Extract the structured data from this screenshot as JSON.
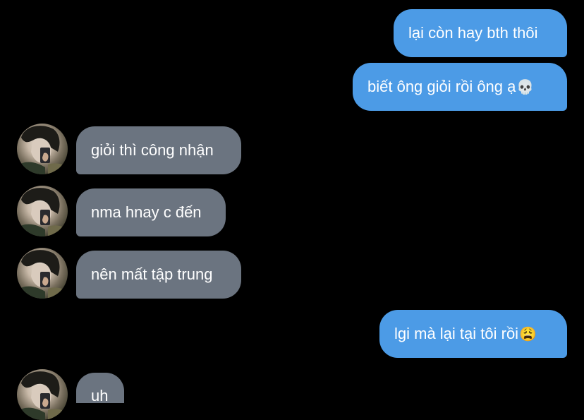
{
  "messages": [
    {
      "id": "m1",
      "direction": "sent",
      "text": "lại còn hay bth thôi",
      "emoji": ""
    },
    {
      "id": "m2",
      "direction": "sent",
      "text": "biết ông giỏi rồi ông ạ",
      "emoji": "💀"
    },
    {
      "id": "m3",
      "direction": "received",
      "text": "giỏi thì công nhận",
      "emoji": ""
    },
    {
      "id": "m4",
      "direction": "received",
      "text": "nma hnay c đến",
      "emoji": ""
    },
    {
      "id": "m5",
      "direction": "received",
      "text": "nên mất tập trung",
      "emoji": ""
    },
    {
      "id": "m6",
      "direction": "sent",
      "text": "lgi mà lại tại tôi rồi",
      "emoji": "😩"
    },
    {
      "id": "m7",
      "direction": "received",
      "text": "uh",
      "emoji": ""
    }
  ],
  "colors": {
    "background": "#000000",
    "sent_bubble": "#4c9be6",
    "received_bubble": "#6b7480",
    "text": "#ffffff"
  },
  "icons": {
    "contact_avatar": "avatar-photo-person"
  }
}
